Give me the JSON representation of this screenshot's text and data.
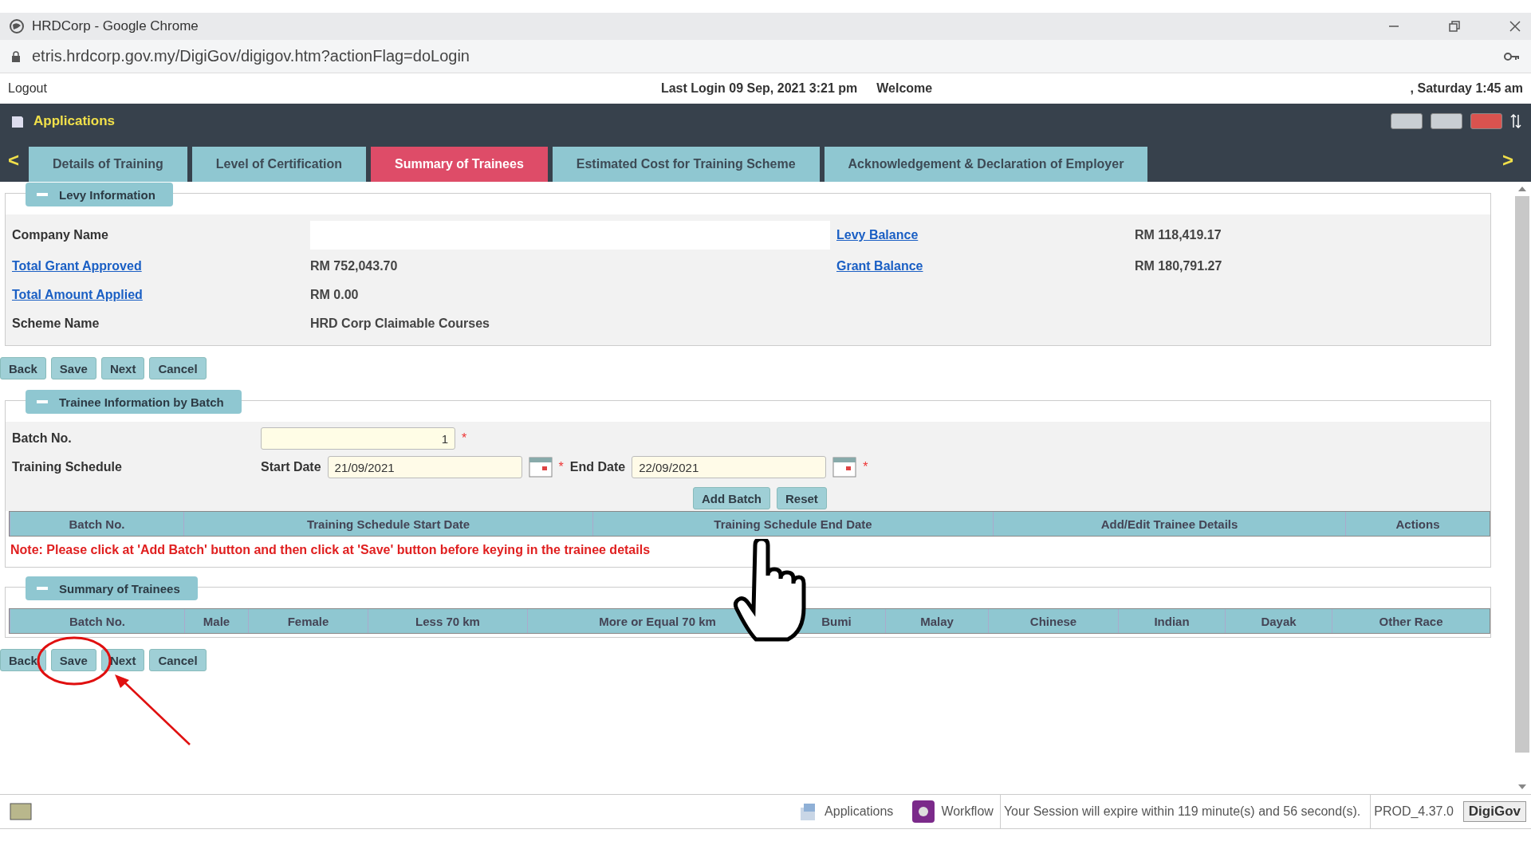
{
  "browser": {
    "title": "HRDCorp - Google Chrome",
    "url": "etris.hrdcorp.gov.my/DigiGov/digigov.htm?actionFlag=doLogin"
  },
  "header": {
    "logout": "Logout",
    "last_login": "Last Login 09 Sep, 2021 3:21 pm",
    "welcome": "Welcome",
    "datetime": ", Saturday 1:45 am"
  },
  "app": {
    "title": "Applications"
  },
  "nav": {
    "prev": "<",
    "next": ">"
  },
  "tabs": [
    {
      "label": "Details of Training",
      "selected": false
    },
    {
      "label": "Level of Certification",
      "selected": false
    },
    {
      "label": "Summary of Trainees",
      "selected": true
    },
    {
      "label": "Estimated Cost for Training Scheme",
      "selected": false
    },
    {
      "label": "Acknowledgement & Declaration of Employer",
      "selected": false
    }
  ],
  "levy": {
    "legend": "Levy Information",
    "rows": [
      {
        "left": {
          "label": "Company Name",
          "link": false
        },
        "right": {
          "label": "Levy Balance",
          "link": true,
          "value": "RM 118,419.17"
        }
      },
      {
        "left": {
          "label": "Total Grant Approved",
          "link": true,
          "value": "RM 752,043.70"
        },
        "right": {
          "label": "Grant Balance",
          "link": true,
          "value": "RM 180,791.27"
        }
      },
      {
        "left": {
          "label": "Total Amount Applied",
          "link": true,
          "value": "RM 0.00"
        }
      },
      {
        "left": {
          "label": "Scheme Name",
          "link": false,
          "value": "HRD Corp Claimable Courses"
        }
      }
    ]
  },
  "top_buttons": [
    "Back",
    "Save",
    "Next",
    "Cancel"
  ],
  "trainee": {
    "legend": "Trainee Information by Batch",
    "batch_label": "Batch No.",
    "batch_value": "1",
    "required": "*",
    "schedule_label": "Training Schedule",
    "start_label": "Start Date",
    "start_value": "21/09/2021",
    "end_label": "End Date",
    "end_value": "22/09/2021",
    "add_batch": "Add Batch",
    "reset": "Reset",
    "columns": [
      "Batch No.",
      "Training Schedule Start Date",
      "Training Schedule End Date",
      "Add/Edit Trainee Details",
      "Actions"
    ],
    "note": "Note: Please click at 'Add Batch' button and then click at 'Save' button before keying in the trainee details"
  },
  "summary": {
    "legend": "Summary of Trainees",
    "columns": [
      "Batch No.",
      "Male",
      "Female",
      "Less 70 km",
      "More or Equal 70 km",
      "Bumi",
      "Malay",
      "Chinese",
      "Indian",
      "Dayak",
      "Other Race"
    ]
  },
  "bottom_buttons": [
    "Back",
    "Save",
    "Next",
    "Cancel"
  ],
  "status_bar": {
    "applications": "Applications",
    "workflow": "Workflow",
    "session": "Your Session will expire within 119 minute(s) and 56 second(s).",
    "version": "PROD_4.37.0",
    "logo": "DigiGov"
  }
}
